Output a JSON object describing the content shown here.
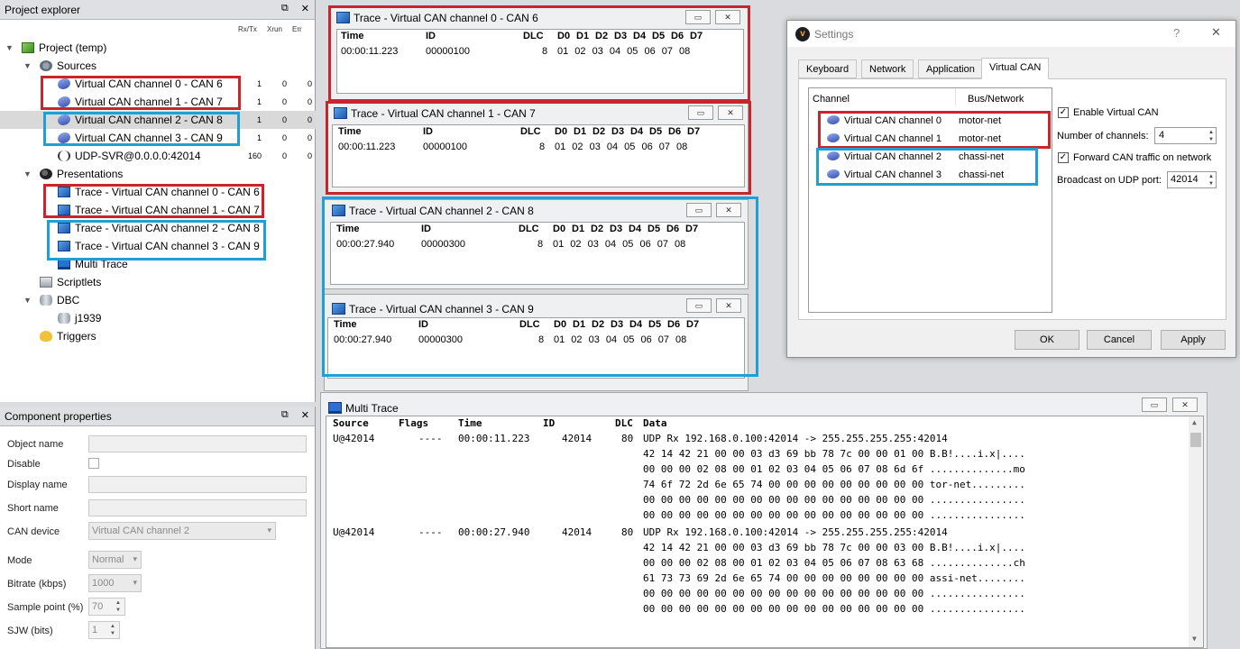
{
  "project_explorer": {
    "title": "Project explorer",
    "columns": [
      "Rx/Tx",
      "Xrun",
      "Err"
    ],
    "project": "Project (temp)",
    "sources_label": "Sources",
    "sources": [
      {
        "name": "Virtual CAN channel 0 - CAN 6",
        "rx": "1",
        "xrun": "0",
        "err": "0"
      },
      {
        "name": "Virtual CAN channel 1 - CAN 7",
        "rx": "1",
        "xrun": "0",
        "err": "0"
      },
      {
        "name": "Virtual CAN channel 2 - CAN 8",
        "rx": "1",
        "xrun": "0",
        "err": "0"
      },
      {
        "name": "Virtual CAN channel 3 - CAN 9",
        "rx": "1",
        "xrun": "0",
        "err": "0"
      },
      {
        "name": "UDP-SVR@0.0.0.0:42014",
        "rx": "160",
        "xrun": "0",
        "err": "0"
      }
    ],
    "presentations_label": "Presentations",
    "presentations": [
      "Trace - Virtual CAN channel 0 - CAN 6",
      "Trace - Virtual CAN channel 1 - CAN 7",
      "Trace - Virtual CAN channel 2 - CAN 8",
      "Trace - Virtual CAN channel 3 - CAN 9",
      "Multi Trace"
    ],
    "scriptlets_label": "Scriptlets",
    "dbc_label": "DBC",
    "dbc_items": [
      "j1939"
    ],
    "triggers_label": "Triggers"
  },
  "component_properties": {
    "title": "Component properties",
    "object_name": "Object name",
    "disable": "Disable",
    "display_name": "Display name",
    "short_name": "Short name",
    "can_device": "CAN device",
    "can_device_value": "Virtual CAN channel 2",
    "mode": "Mode",
    "mode_value": "Normal",
    "bitrate": "Bitrate (kbps)",
    "bitrate_value": "1000",
    "sample_point": "Sample point (%)",
    "sample_point_value": "70",
    "sjw": "SJW (bits)",
    "sjw_value": "1"
  },
  "trace_headers": {
    "time": "Time",
    "id": "ID",
    "dlc": "DLC",
    "data": [
      "D0",
      "D1",
      "D2",
      "D3",
      "D4",
      "D5",
      "D6",
      "D7"
    ]
  },
  "traces": [
    {
      "title": "Trace - Virtual CAN channel 0 - CAN 6",
      "time": "00:00:11.223",
      "id": "00000100",
      "dlc": "8",
      "data": "01 02 03 04 05 06 07 08"
    },
    {
      "title": "Trace - Virtual CAN channel 1 - CAN 7",
      "time": "00:00:11.223",
      "id": "00000100",
      "dlc": "8",
      "data": "01 02 03 04 05 06 07 08"
    },
    {
      "title": "Trace - Virtual CAN channel 2 - CAN 8",
      "time": "00:00:27.940",
      "id": "00000300",
      "dlc": "8",
      "data": "01 02 03 04 05 06 07 08"
    },
    {
      "title": "Trace - Virtual CAN channel 3 - CAN 9",
      "time": "00:00:27.940",
      "id": "00000300",
      "dlc": "8",
      "data": "01 02 03 04 05 06 07 08"
    }
  ],
  "settings": {
    "title": "Settings",
    "help": "?",
    "close": "✕",
    "tabs": [
      "Keyboard",
      "Network",
      "Application",
      "Virtual CAN"
    ],
    "col_channel": "Channel",
    "col_bus": "Bus/Network",
    "channels": [
      {
        "name": "Virtual CAN channel 0",
        "bus": "motor-net"
      },
      {
        "name": "Virtual CAN channel 1",
        "bus": "motor-net"
      },
      {
        "name": "Virtual CAN channel 2",
        "bus": "chassi-net"
      },
      {
        "name": "Virtual CAN channel 3",
        "bus": "chassi-net"
      }
    ],
    "enable_label": "Enable Virtual CAN",
    "num_channels_label": "Number of channels:",
    "num_channels_value": "4",
    "forward_label": "Forward CAN traffic on network",
    "udp_port_label": "Broadcast on UDP port:",
    "udp_port_value": "42014",
    "ok": "OK",
    "cancel": "Cancel",
    "apply": "Apply"
  },
  "multi_trace": {
    "title": "Multi Trace",
    "headers": [
      "Source",
      "Flags",
      "Time",
      "ID",
      "DLC",
      "Data"
    ],
    "rows": [
      {
        "source": "U@42014",
        "flags": "----",
        "time": "00:00:11.223",
        "id": "42014",
        "dlc": "80",
        "data": "UDP Rx 192.168.0.100:42014 -> 255.255.255.255:42014"
      },
      {
        "data": "42 14 42 21 00 00 03 d3 69 bb 78 7c 00 00 01 00 B.B!....i.x|...."
      },
      {
        "data": "00 00 00 02 08 00 01 02 03 04 05 06 07 08 6d 6f ..............mo"
      },
      {
        "data": "74 6f 72 2d 6e 65 74 00 00 00 00 00 00 00 00 00 tor-net........."
      },
      {
        "data": "00 00 00 00 00 00 00 00 00 00 00 00 00 00 00 00 ................"
      },
      {
        "data": "00 00 00 00 00 00 00 00 00 00 00 00 00 00 00 00 ................"
      },
      {
        "source": "U@42014",
        "flags": "----",
        "time": "00:00:27.940",
        "id": "42014",
        "dlc": "80",
        "data": "UDP Rx 192.168.0.100:42014 -> 255.255.255.255:42014"
      },
      {
        "data": "42 14 42 21 00 00 03 d3 69 bb 78 7c 00 00 03 00 B.B!....i.x|...."
      },
      {
        "data": "00 00 00 02 08 00 01 02 03 04 05 06 07 08 63 68 ..............ch"
      },
      {
        "data": "61 73 73 69 2d 6e 65 74 00 00 00 00 00 00 00 00 assi-net........"
      },
      {
        "data": "00 00 00 00 00 00 00 00 00 00 00 00 00 00 00 00 ................"
      },
      {
        "data": "00 00 00 00 00 00 00 00 00 00 00 00 00 00 00 00 ................"
      }
    ]
  },
  "colors": {
    "highlight_red": "#c8262c",
    "highlight_blue": "#1f9fd4"
  }
}
